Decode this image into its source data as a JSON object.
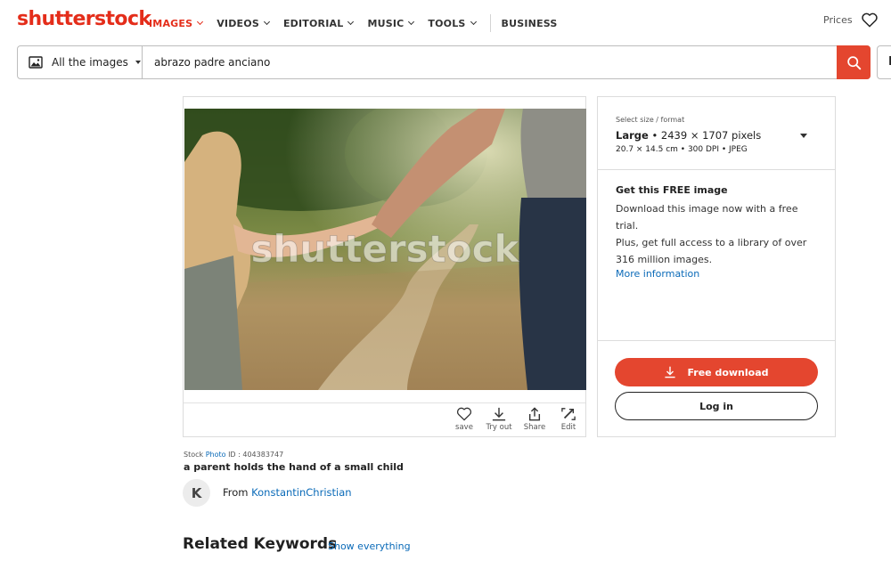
{
  "header": {
    "logo_text": "shutterstock",
    "nav": [
      {
        "label": "IMAGES",
        "active": true,
        "dropdown": true
      },
      {
        "label": "VIDEOS",
        "active": false,
        "dropdown": true
      },
      {
        "label": "EDITORIAL",
        "active": false,
        "dropdown": true
      },
      {
        "label": "MUSIC",
        "active": false,
        "dropdown": true
      },
      {
        "label": "TOOLS",
        "active": false,
        "dropdown": true
      },
      {
        "label": "BUSINESS",
        "active": false,
        "dropdown": false
      }
    ],
    "prices_label": "Prices",
    "favorites_icon": "heart-outline-icon"
  },
  "search": {
    "category_label": "All the images",
    "category_icon": "image-icon",
    "query": "abrazo padre anciano",
    "button_icon": "search-icon",
    "button_color": "#e4462f",
    "edge_button_label": "D"
  },
  "image": {
    "watermark": "shutterstock",
    "actions": [
      {
        "icon": "heart-icon",
        "label": "save"
      },
      {
        "icon": "download-icon",
        "label": "Try out"
      },
      {
        "icon": "share-icon",
        "label": "Share"
      },
      {
        "icon": "edit-icon",
        "label": "Edit"
      }
    ],
    "type_label": "Stock",
    "type_link": "Photo",
    "id_label": "ID : 404383747",
    "description": "a parent holds the hand of a small child",
    "contributor_initial": "K",
    "from_label": "From",
    "contributor": "KonstantinChristian"
  },
  "related": {
    "title": "Related Keywords",
    "show_all": "Show everything"
  },
  "panel": {
    "size_label": "Select size / format",
    "size_name": "Large",
    "size_pixels": "• 2439 × 1707 pixels",
    "size_details": "20.7 × 14.5 cm • 300 DPI • JPEG",
    "free_title": "Get this FREE image",
    "free_text_1": "Download this image now with a free trial.",
    "free_text_2": "Plus, get full access to a library of over 316 million images.",
    "more_info": "More information",
    "download_label": "Free download",
    "login_label": "Log in",
    "accent_color": "#e4462f",
    "link_color": "#0a6ab8"
  }
}
